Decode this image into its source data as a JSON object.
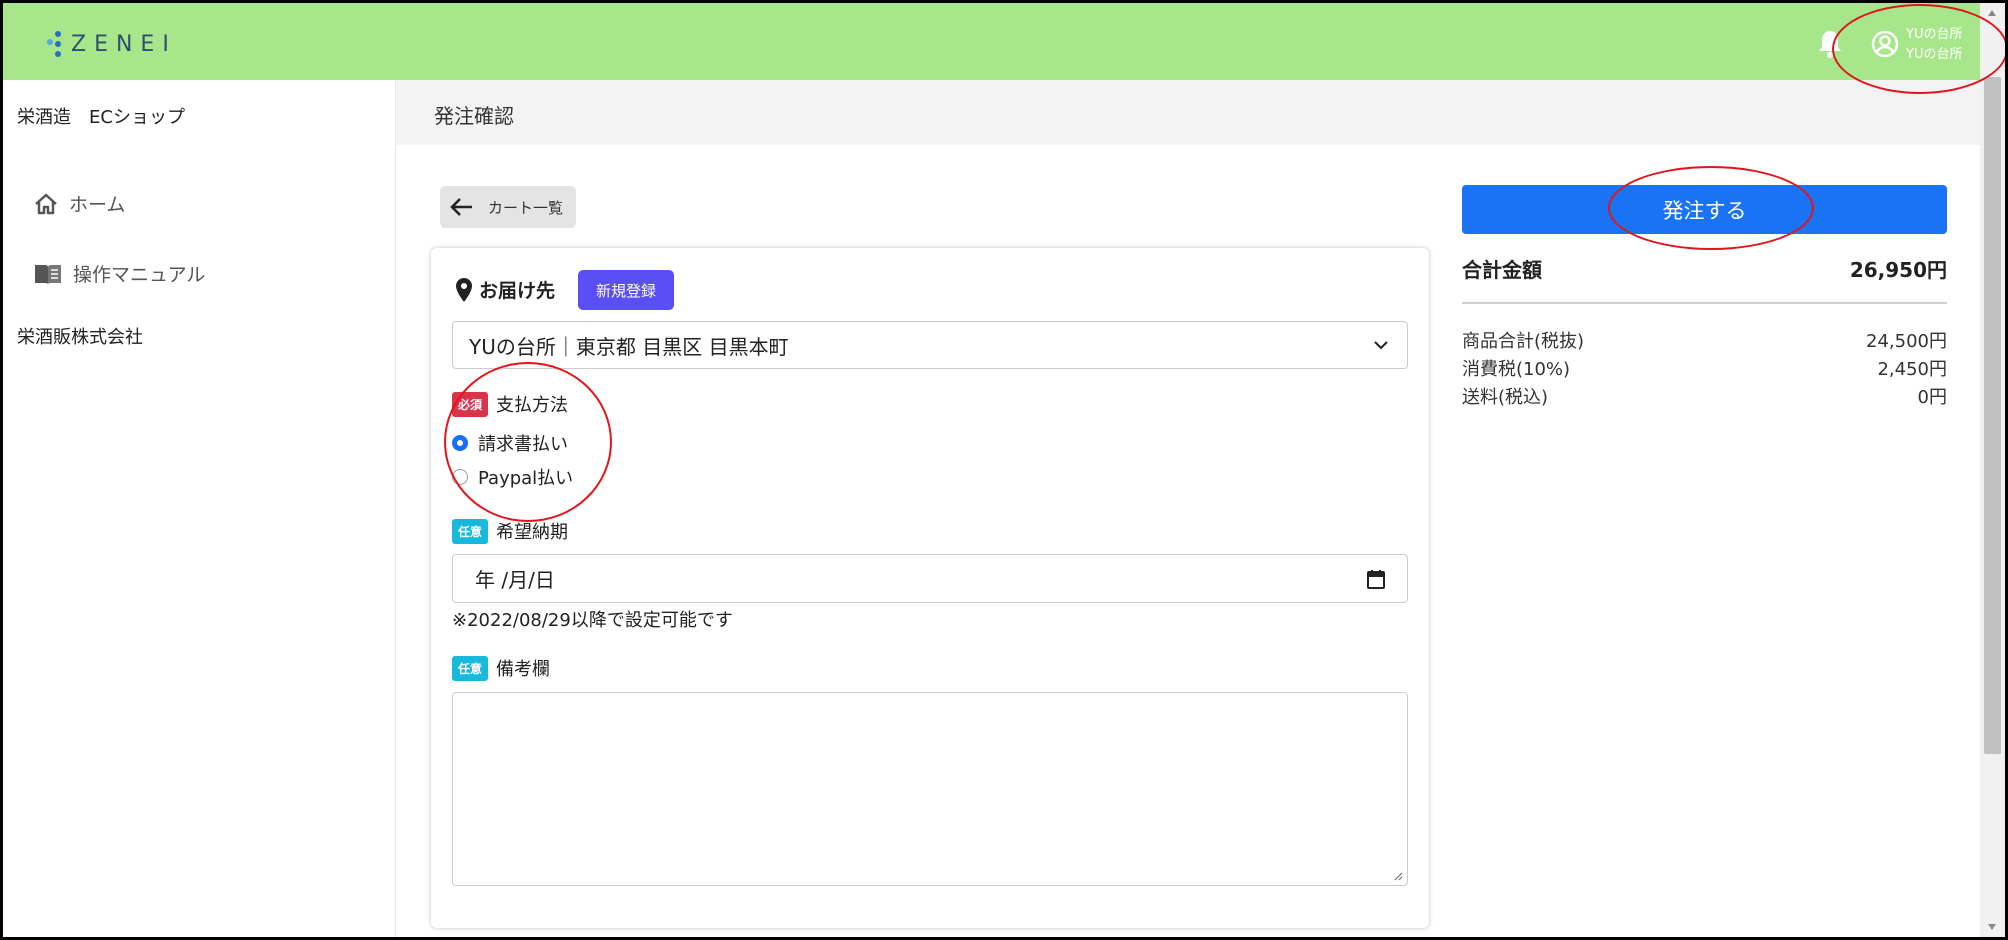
{
  "app": {
    "logo_text": "ZENEI",
    "brand_colors": {
      "header": "#a8e68c",
      "primary": "#1a73f5",
      "new_button": "#5a4ff5",
      "required": "#d9344a",
      "optional": "#17b9dd"
    }
  },
  "header": {
    "user_line1": "YUの台所",
    "user_line2": "YUの台所",
    "icons": [
      "bell-icon",
      "user-circle-icon"
    ]
  },
  "sidebar": {
    "shop_name": "栄酒造　ECショップ",
    "items": [
      {
        "label": "ホーム",
        "icon": "home-icon"
      },
      {
        "label": "操作マニュアル",
        "icon": "book-icon"
      }
    ],
    "company": "栄酒販株式会社"
  },
  "page": {
    "title": "発注確認",
    "back_label": "カート一覧"
  },
  "form": {
    "delivery": {
      "title": "お届け先",
      "new_button": "新規登録",
      "selected": "YUの台所｜東京都 目黒区 目黒本町"
    },
    "payment": {
      "badge": "必須",
      "label": "支払方法",
      "options": [
        {
          "label": "請求書払い",
          "checked": true
        },
        {
          "label": "Paypal払い",
          "checked": false
        }
      ]
    },
    "delivery_date": {
      "badge": "任意",
      "label": "希望納期",
      "placeholder": "年 /月/日",
      "hint": "※2022/08/29以降で設定可能です"
    },
    "notes": {
      "badge": "任意",
      "label": "備考欄",
      "value": ""
    }
  },
  "summary": {
    "order_button": "発注する",
    "total_label": "合計金額",
    "total_value": "26,950円",
    "rows": [
      {
        "label": "商品合計(税抜)",
        "value": "24,500円"
      },
      {
        "label": "消費税(10%)",
        "value": "2,450円"
      },
      {
        "label": "送料(税込)",
        "value": "0円"
      }
    ]
  }
}
